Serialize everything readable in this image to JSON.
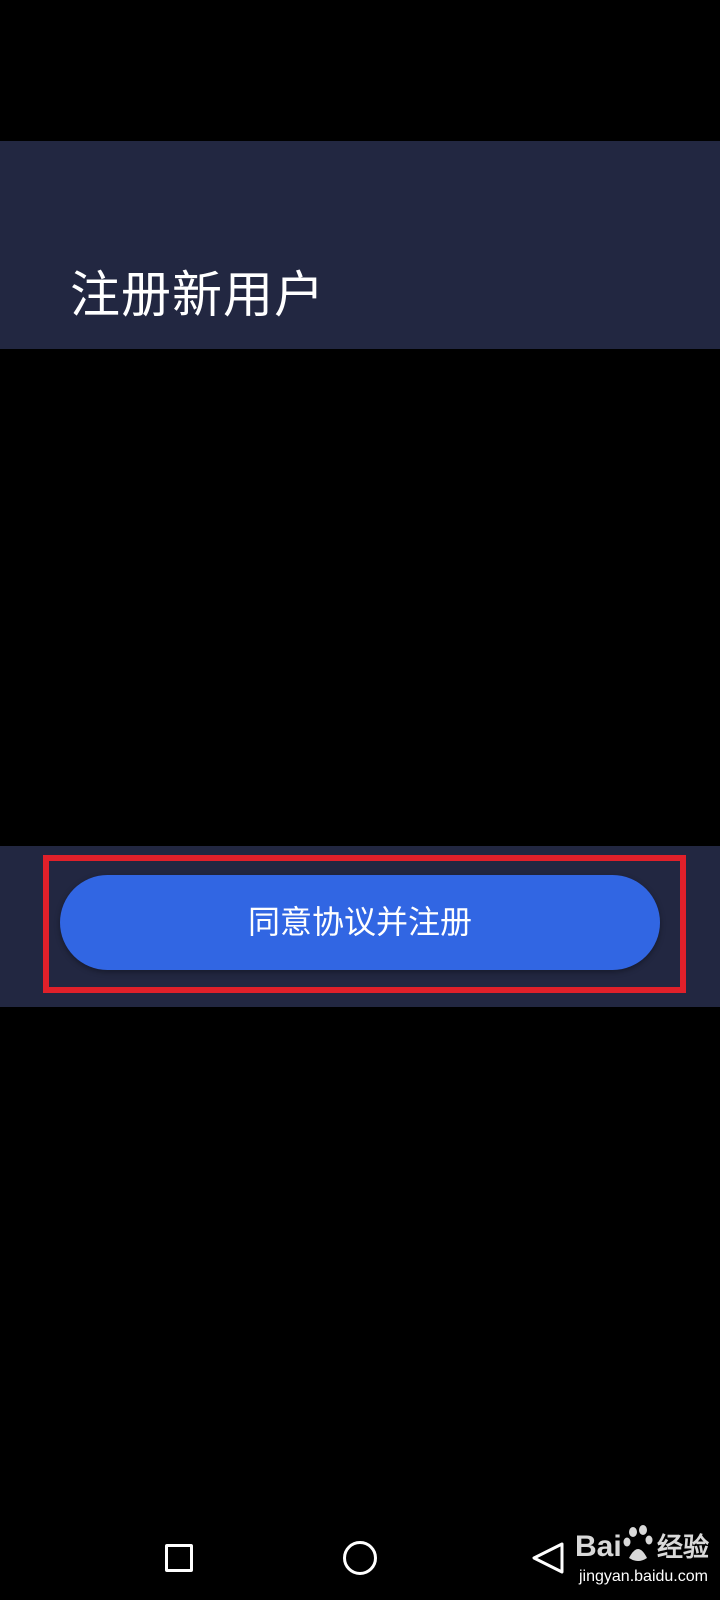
{
  "header": {
    "title": "注册新用户",
    "background": "#222741"
  },
  "footer": {
    "register_button_label": "同意协议并注册",
    "button_color": "#3166e3",
    "highlight_color": "#e0202a",
    "background": "#222741"
  },
  "nav": {
    "recent_icon": "square-icon",
    "home_icon": "circle-icon",
    "back_icon": "triangle-back-icon"
  },
  "watermark": {
    "brand": "Bai经验",
    "url": "jingyan.baidu.com"
  }
}
